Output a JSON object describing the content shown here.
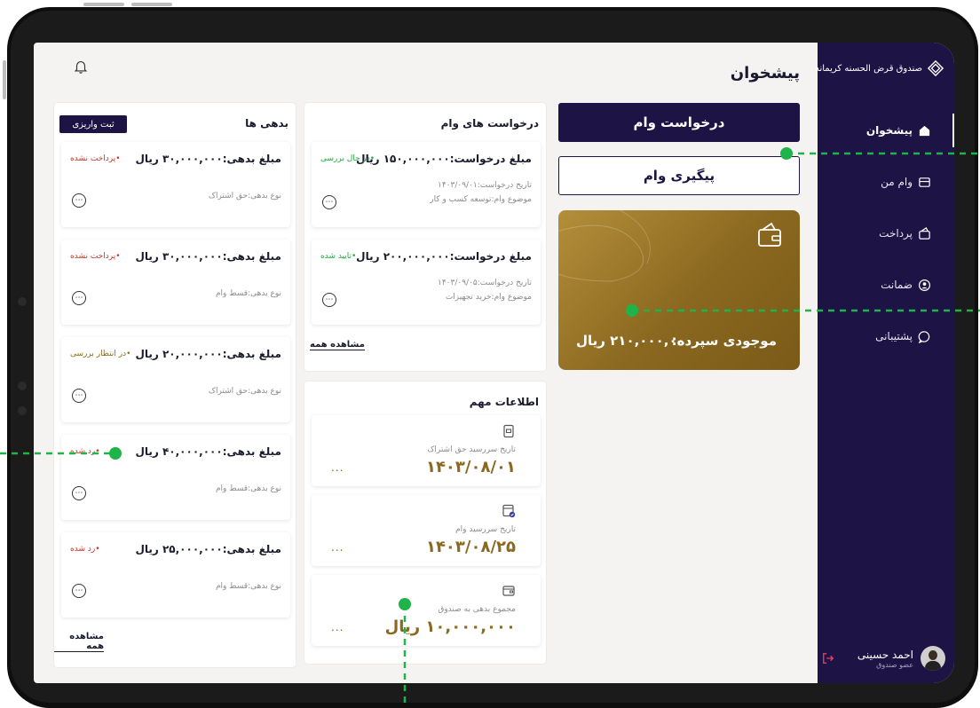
{
  "brand": {
    "name": "صندوق قرض الحسنه کریمانه"
  },
  "header": {
    "title": "پیشخوان"
  },
  "sidebar": {
    "items": [
      {
        "label": "پیشخوان",
        "icon": "home-icon",
        "active": true
      },
      {
        "label": "وام من",
        "icon": "card-icon"
      },
      {
        "label": "پرداخت",
        "icon": "wallet-icon"
      },
      {
        "label": "ضمانت",
        "icon": "user-circle-icon"
      },
      {
        "label": "پشتیبانی",
        "icon": "chat-icon"
      }
    ],
    "user": {
      "name": "احمد حسینی",
      "role": "عضو صندوق"
    }
  },
  "actions": {
    "request_loan": "درخواست وام",
    "track_loan": "پیگیری وام"
  },
  "deposit": {
    "label": "موجودی سپرده:",
    "value": "۲۱۰,۰۰۰,۰۰۰ ریال"
  },
  "loan_requests": {
    "title": "درخواست های وام",
    "view_all": "مشاهده همه",
    "items": [
      {
        "amount": "مبلغ درخواست:۱۵۰,۰۰۰,۰۰۰ ریال",
        "status": "•در حال بررسی",
        "date": "تاریخ درخواست:۱۴۰۳/۰۹/۰۱",
        "subject": "موضوع وام:توسعه کسب و کار"
      },
      {
        "amount": "مبلغ درخواست:۲۰۰,۰۰۰,۰۰۰ ریال",
        "status": "•تایید شده",
        "date": "تاریخ درخواست:۱۴۰۳/۰۹/۰۵",
        "subject": "موضوع وام:خرید تجهیزات"
      }
    ]
  },
  "important_info": {
    "title": "اطلاعات مهم",
    "more": "...",
    "items": [
      {
        "label": "تاریخ سررسید حق اشتراک",
        "value": "۱۴۰۳/۰۸/۰۱"
      },
      {
        "label": "تاریخ سررسید وام",
        "value": "۱۴۰۳/۰۸/۲۵"
      },
      {
        "label": "مجموع بدهی به صندوق",
        "value": "۱۰,۰۰۰,۰۰۰ ریال"
      }
    ]
  },
  "debts": {
    "title": "بدهی ها",
    "register_button": "ثبت واریزی",
    "view_all": "مشاهده همه",
    "items": [
      {
        "amount": "مبلغ بدهی:۳۰,۰۰۰,۰۰۰ ریال",
        "status": "•پرداخت نشده",
        "type": "نوع بدهی:حق اشتراک"
      },
      {
        "amount": "مبلغ بدهی:۳۰,۰۰۰,۰۰۰ ریال",
        "status": "•پرداخت نشده",
        "type": "نوع بدهی:قسط وام"
      },
      {
        "amount": "مبلغ بدهی:۲۰,۰۰۰,۰۰۰ ریال",
        "status": "•در انتظار بررسی",
        "type": "نوع بدهی:حق اشتراک"
      },
      {
        "amount": "مبلغ بدهی:۴۰,۰۰۰,۰۰۰ ریال",
        "status": "•رد شده",
        "type": "نوع بدهی:قسط وام"
      },
      {
        "amount": "مبلغ بدهی:۲۵,۰۰۰,۰۰۰ ریال",
        "status": "•رد شده",
        "type": "نوع بدهی:قسط وام"
      }
    ]
  },
  "colors": {
    "primary": "#1d1445",
    "gold": "#8a6820",
    "status_unpaid": "#c0392b",
    "status_pending": "#8a6d1a",
    "status_approved": "#27a844",
    "annotation": "#1fb44a"
  }
}
